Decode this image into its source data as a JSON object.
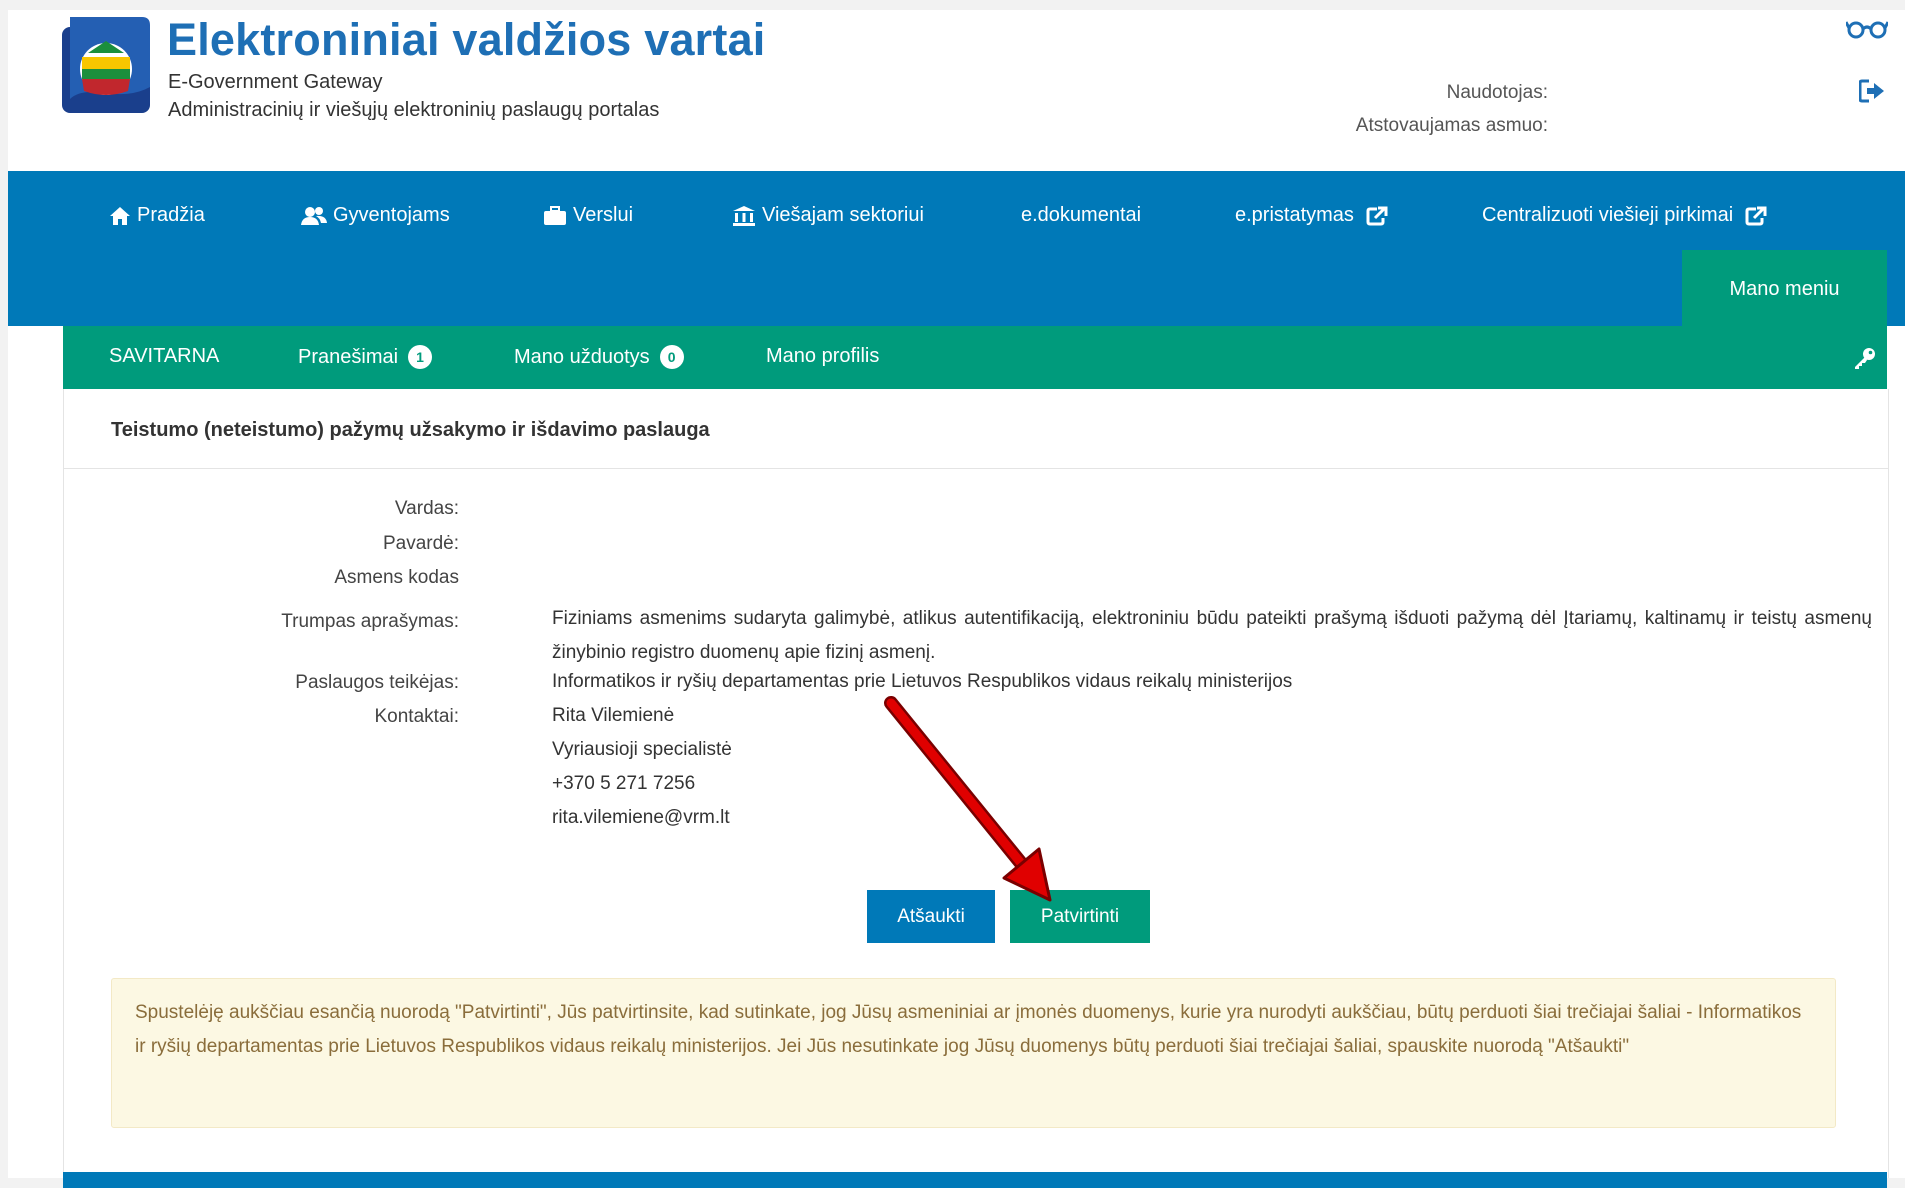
{
  "header": {
    "title": "Elektroniniai valdžios vartai",
    "subtitle_en": "E-Government Gateway",
    "subtitle_lt": "Administracinių ir viešųjų elektroninių paslaugų portalas",
    "user_label": "Naudotojas:",
    "represented_label": "Atstovaujamas asmuo:"
  },
  "topnav": {
    "items": [
      {
        "label": "Pradžia",
        "icon": "home-icon"
      },
      {
        "label": "Gyventojams",
        "icon": "users-icon"
      },
      {
        "label": "Verslui",
        "icon": "briefcase-icon"
      },
      {
        "label": "Viešajam sektoriui",
        "icon": "institution-icon"
      },
      {
        "label": "e.dokumentai"
      },
      {
        "label": "e.pristatymas",
        "icon": "external-link-icon"
      },
      {
        "label": "Centralizuoti viešieji pirkimai",
        "icon": "external-link-icon"
      }
    ],
    "mano_meniu": "Mano meniu"
  },
  "subnav": {
    "items": [
      {
        "label": "SAVITARNA"
      },
      {
        "label": "Pranešimai",
        "badge": "1"
      },
      {
        "label": "Mano užduotys",
        "badge": "0"
      },
      {
        "label": "Mano profilis"
      }
    ]
  },
  "panel": {
    "title": "Teistumo (neteistumo) pažymų užsakymo ir išdavimo paslauga",
    "fields": {
      "vardas_label": "Vardas:",
      "pavarde_label": "Pavardė:",
      "asmens_kodas_label": "Asmens kodas",
      "description_label": "Trumpas aprašymas:",
      "description": "Fiziniams asmenims sudaryta galimybė, atlikus autentifikaciją, elektroniniu būdu pateikti prašymą išduoti pažymą dėl Įtariamų, kaltinamų ir teistų asmenų žinybinio registro duomenų apie fizinį asmenį.",
      "provider_label": "Paslaugos teikėjas:",
      "provider": "Informatikos ir ryšių departamentas prie Lietuvos Respublikos vidaus reikalų ministerijos",
      "contacts_label": "Kontaktai:",
      "contact_name": "Rita Vilemienė",
      "contact_position": "Vyriausioji specialistė",
      "contact_phone": "+370 5 271 7256",
      "contact_email": "rita.vilemiene@vrm.lt"
    },
    "buttons": {
      "cancel": "Atšaukti",
      "confirm": "Patvirtinti"
    },
    "alert": "Spustelėję aukščiau esančią nuorodą \"Patvirtinti\", Jūs patvirtinsite, kad sutinkate, jog Jūsų asmeniniai ar įmonės duomenys, kurie yra nurodyti aukščiau, būtų perduoti šiai trečiajai šaliai - Informatikos ir ryšių departamentas prie Lietuvos Respublikos vidaus reikalų ministerijos. Jei Jūs nesutinkate jog Jūsų duomenys būtų perduoti šiai trečiajai šaliai, spauskite nuorodą \"Atšaukti\""
  },
  "colors": {
    "primary_blue": "#0079b8",
    "green": "#009b7c",
    "title_blue": "#1e6fb5",
    "alert_bg": "#fcf8e3",
    "alert_text": "#8a6d3b",
    "annotation_arrow": "#e00000"
  }
}
